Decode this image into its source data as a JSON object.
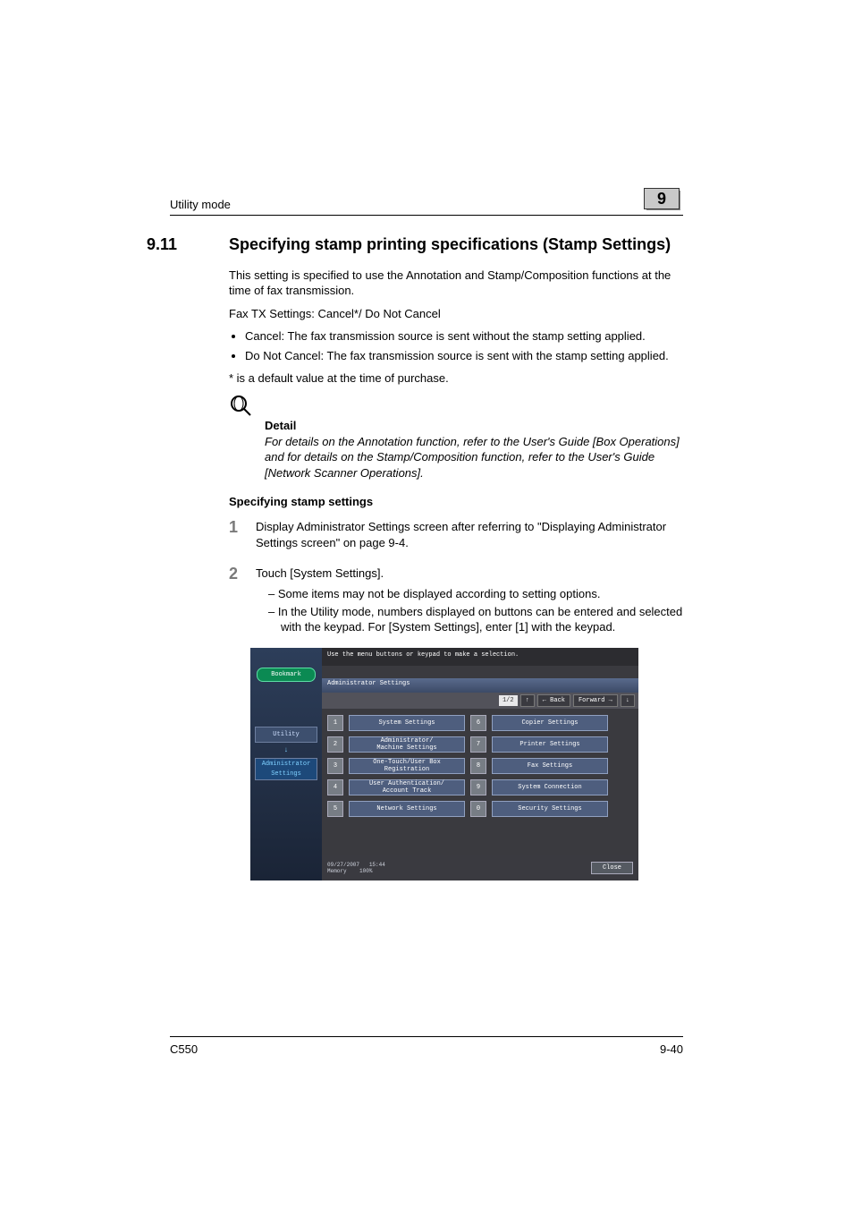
{
  "header": {
    "left": "Utility mode",
    "chapter": "9"
  },
  "section": {
    "number": "9.11",
    "title": "Specifying stamp printing specifications (Stamp Settings)",
    "intro": "This setting is specified to use the Annotation and Stamp/Composition functions at the time of fax transmission.",
    "fax_line": "Fax TX Settings: Cancel*/ Do Not Cancel",
    "bullets": [
      "Cancel: The fax transmission source is sent without the stamp setting applied.",
      "Do Not Cancel: The fax transmission source is sent with the stamp setting applied."
    ],
    "note": "* is a default value at the time of purchase."
  },
  "detail": {
    "label": "Detail",
    "text": "For details on the Annotation function, refer to the User's Guide [Box Operations] and for details on the Stamp/Composition function, refer to the User's Guide [Network Scanner Operations]."
  },
  "subheading": "Specifying stamp settings",
  "steps": [
    {
      "num": "1",
      "text": "Display Administrator Settings screen after referring to \"Displaying Administrator Settings screen\" on page 9-4.",
      "subs": []
    },
    {
      "num": "2",
      "text": "Touch [System Settings].",
      "subs": [
        "Some items may not be displayed according to setting options.",
        "In the Utility mode, numbers displayed on buttons can be entered and selected with the keypad. For [System Settings], enter [1] with the keypad."
      ]
    }
  ],
  "panel": {
    "instruction": "Use the menu buttons or keypad to make a selection.",
    "bookmark": "Bookmark",
    "side_tab1": "Utility",
    "side_tab2": "Administrator\nSettings",
    "titlebar": "Administrator Settings",
    "pager": "1/2",
    "back": "← Back",
    "forward": "Forward →",
    "options": [
      {
        "n": "1",
        "label": "System Settings"
      },
      {
        "n": "6",
        "label": "Copier Settings"
      },
      {
        "n": "2",
        "label": "Administrator/\nMachine Settings"
      },
      {
        "n": "7",
        "label": "Printer Settings"
      },
      {
        "n": "3",
        "label": "One-Touch/User Box\nRegistration"
      },
      {
        "n": "8",
        "label": "Fax Settings"
      },
      {
        "n": "4",
        "label": "User Authentication/\nAccount Track"
      },
      {
        "n": "9",
        "label": "System Connection"
      },
      {
        "n": "5",
        "label": "Network Settings"
      },
      {
        "n": "0",
        "label": "Security Settings"
      }
    ],
    "footer_date": "09/27/2007",
    "footer_time": "15:44",
    "footer_mem_label": "Memory",
    "footer_mem_val": "100%",
    "close": "Close"
  },
  "footer": {
    "left": "C550",
    "right": "9-40"
  }
}
